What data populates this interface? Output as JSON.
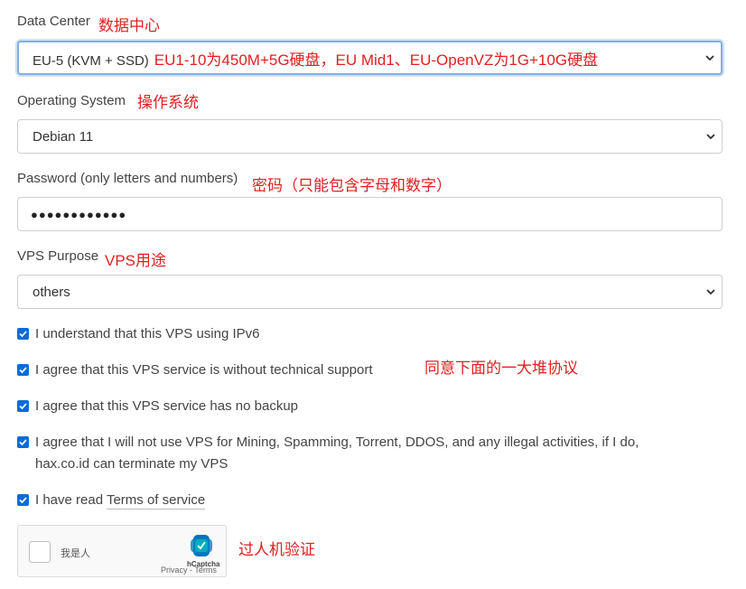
{
  "data_center": {
    "label": "Data Center",
    "note": "数据中心",
    "selected": "EU-5 (KVM + SSD)",
    "selected_note": "EU1-10为450M+5G硬盘，EU Mid1、EU-OpenVZ为1G+10G硬盘"
  },
  "os": {
    "label": "Operating System",
    "note": "操作系统",
    "selected": "Debian 11"
  },
  "password": {
    "label": "Password (only letters and numbers)",
    "note": "密码（只能包含字母和数字）",
    "value": "●●●●●●●●●●●●"
  },
  "purpose": {
    "label": "VPS Purpose",
    "note": "VPS用途",
    "selected": "others"
  },
  "checks": [
    {
      "text": "I understand that this VPS using IPv6"
    },
    {
      "text": "I agree that this VPS service is without technical support"
    },
    {
      "text": "I agree that this VPS service has no backup"
    },
    {
      "text_line1": "I agree that I will not use VPS for Mining, Spamming, Torrent, DDOS, and any illegal activities, if I do,",
      "text_line2": "hax.co.id can terminate my VPS"
    },
    {
      "text_prefix": "I have read",
      "link": "Terms of service"
    }
  ],
  "agreements_note": "同意下面的一大堆协议",
  "captcha": {
    "label": "我是人",
    "brand": "hCaptcha",
    "links": "Privacy - Terms",
    "note": "过人机验证"
  },
  "colors": {
    "accent": "#0b6bd6",
    "note_red": "#e02020",
    "focus_border": "#80aee8"
  }
}
